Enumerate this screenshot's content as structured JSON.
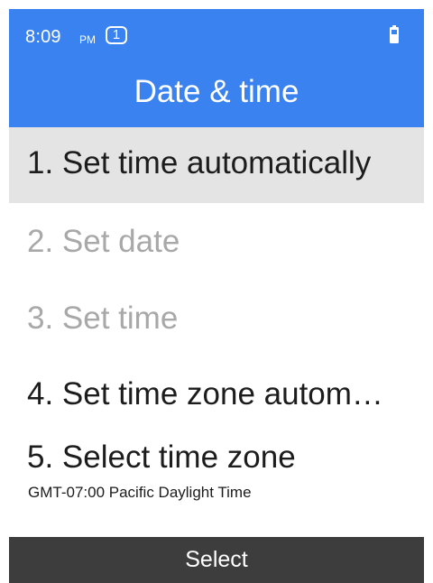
{
  "status_bar": {
    "time": "8:09",
    "ampm": "PM",
    "sim_slot": "1",
    "battery_icon": "battery-icon"
  },
  "header": {
    "title": "Date & time"
  },
  "menu": {
    "items": [
      {
        "label": "1. Set time automatically",
        "state": "selected"
      },
      {
        "label": "2. Set date",
        "state": "disabled"
      },
      {
        "label": "3. Set time",
        "state": "disabled"
      },
      {
        "label": "4. Set time zone autom…",
        "state": "enabled"
      },
      {
        "label": "5. Select time zone",
        "sublabel": "GMT-07:00 Pacific Daylight Time",
        "state": "enabled"
      }
    ]
  },
  "softkey": {
    "center_label": "Select"
  },
  "colors": {
    "header_bg": "#3b82f1",
    "selected_bg": "#e4e4e4",
    "disabled_text": "#a8a8a8",
    "softkey_bg": "#3d3d3d"
  }
}
